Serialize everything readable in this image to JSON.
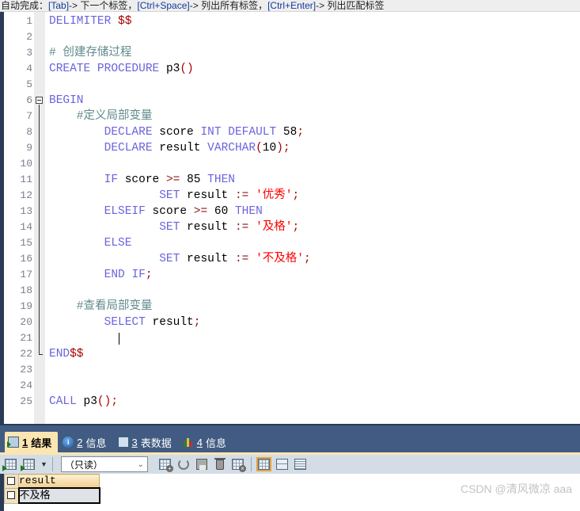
{
  "hint_bar": {
    "prefix": "自动完成：",
    "items": [
      {
        "key": "[Tab]",
        "desc": "-> 下一个标签，"
      },
      {
        "key": "[Ctrl+Space]",
        "desc": "-> 列出所有标签，"
      },
      {
        "key": "[Ctrl+Enter]",
        "desc": "-> 列出匹配标签"
      }
    ]
  },
  "editor": {
    "language": "sql",
    "lines": [
      {
        "n": "1",
        "text": "DELIMITER $$"
      },
      {
        "n": "2",
        "text": ""
      },
      {
        "n": "3",
        "text": "# 创建存储过程"
      },
      {
        "n": "4",
        "text": "CREATE PROCEDURE p3()"
      },
      {
        "n": "5",
        "text": ""
      },
      {
        "n": "6",
        "text": "BEGIN"
      },
      {
        "n": "7",
        "text": "    #定义局部变量"
      },
      {
        "n": "8",
        "text": "        DECLARE score INT DEFAULT 58;"
      },
      {
        "n": "9",
        "text": "        DECLARE result VARCHAR(10);"
      },
      {
        "n": "10",
        "text": ""
      },
      {
        "n": "11",
        "text": "        IF score >= 85 THEN"
      },
      {
        "n": "12",
        "text": "                SET result := '优秀';"
      },
      {
        "n": "13",
        "text": "        ELSEIF score >= 60 THEN"
      },
      {
        "n": "14",
        "text": "                SET result := '及格';"
      },
      {
        "n": "15",
        "text": "        ELSE"
      },
      {
        "n": "16",
        "text": "                SET result := '不及格';"
      },
      {
        "n": "17",
        "text": "        END IF;"
      },
      {
        "n": "18",
        "text": ""
      },
      {
        "n": "19",
        "text": "    #查看局部变量"
      },
      {
        "n": "20",
        "text": "        SELECT result;"
      },
      {
        "n": "21",
        "text": ""
      },
      {
        "n": "22",
        "text": "END$$"
      },
      {
        "n": "23",
        "text": ""
      },
      {
        "n": "24",
        "text": ""
      },
      {
        "n": "25",
        "text": "CALL p3();"
      }
    ],
    "colors": {
      "keyword": "#6a64dd",
      "comment": "#5f8a8b",
      "string": "#ff0000",
      "punctuation": "#aa0000",
      "operator": "#8b1a1a",
      "identifier": "#000000",
      "line_number": "#7b7f8c"
    },
    "cursor_line": "21",
    "fold_from_line": "6",
    "fold_to_line": "22"
  },
  "result_tabs": {
    "items": [
      {
        "num": "1",
        "label": "结果",
        "icon": "result-grid-icon",
        "active": true
      },
      {
        "num": "2",
        "label": "信息",
        "icon": "info-icon",
        "active": false
      },
      {
        "num": "3",
        "label": "表数据",
        "icon": "table-data-icon",
        "active": false
      },
      {
        "num": "4",
        "label": "信息",
        "icon": "chart-info-icon",
        "active": false
      }
    ],
    "bar_color": "#415b82",
    "active_tab_color": "#fbe6b2"
  },
  "result_toolbar": {
    "buttons": [
      {
        "name": "insert-record-button",
        "icon": "grid-insert-icon"
      },
      {
        "name": "apply-changes-button",
        "icon": "grid-apply-icon"
      },
      {
        "name": "dropdown-button",
        "icon": "chevron-down-icon"
      },
      {
        "name": "add-record-button",
        "icon": "record-add-icon"
      },
      {
        "name": "refresh-button",
        "icon": "refresh-icon"
      },
      {
        "name": "save-button",
        "icon": "floppy-disk-icon"
      },
      {
        "name": "delete-button",
        "icon": "trash-icon"
      },
      {
        "name": "cancel-changes-button",
        "icon": "record-cancel-icon"
      },
      {
        "name": "grid-view-button",
        "icon": "grid-view-icon"
      },
      {
        "name": "form-view-button",
        "icon": "form-view-icon"
      },
      {
        "name": "text-view-button",
        "icon": "text-view-icon"
      }
    ],
    "mode_select": {
      "value": "（只读）",
      "chevron": "⌄"
    }
  },
  "result_grid": {
    "columns": [
      "result"
    ],
    "rows": [
      [
        "不及格"
      ]
    ]
  },
  "watermark": "CSDN @清风微凉 aaa"
}
